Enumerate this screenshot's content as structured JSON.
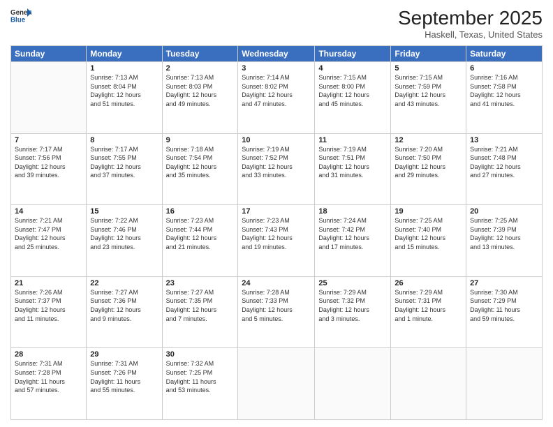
{
  "header": {
    "logo_line1": "General",
    "logo_line2": "Blue",
    "month": "September 2025",
    "location": "Haskell, Texas, United States"
  },
  "weekdays": [
    "Sunday",
    "Monday",
    "Tuesday",
    "Wednesday",
    "Thursday",
    "Friday",
    "Saturday"
  ],
  "weeks": [
    [
      {
        "day": "",
        "info": ""
      },
      {
        "day": "1",
        "info": "Sunrise: 7:13 AM\nSunset: 8:04 PM\nDaylight: 12 hours\nand 51 minutes."
      },
      {
        "day": "2",
        "info": "Sunrise: 7:13 AM\nSunset: 8:03 PM\nDaylight: 12 hours\nand 49 minutes."
      },
      {
        "day": "3",
        "info": "Sunrise: 7:14 AM\nSunset: 8:02 PM\nDaylight: 12 hours\nand 47 minutes."
      },
      {
        "day": "4",
        "info": "Sunrise: 7:15 AM\nSunset: 8:00 PM\nDaylight: 12 hours\nand 45 minutes."
      },
      {
        "day": "5",
        "info": "Sunrise: 7:15 AM\nSunset: 7:59 PM\nDaylight: 12 hours\nand 43 minutes."
      },
      {
        "day": "6",
        "info": "Sunrise: 7:16 AM\nSunset: 7:58 PM\nDaylight: 12 hours\nand 41 minutes."
      }
    ],
    [
      {
        "day": "7",
        "info": "Sunrise: 7:17 AM\nSunset: 7:56 PM\nDaylight: 12 hours\nand 39 minutes."
      },
      {
        "day": "8",
        "info": "Sunrise: 7:17 AM\nSunset: 7:55 PM\nDaylight: 12 hours\nand 37 minutes."
      },
      {
        "day": "9",
        "info": "Sunrise: 7:18 AM\nSunset: 7:54 PM\nDaylight: 12 hours\nand 35 minutes."
      },
      {
        "day": "10",
        "info": "Sunrise: 7:19 AM\nSunset: 7:52 PM\nDaylight: 12 hours\nand 33 minutes."
      },
      {
        "day": "11",
        "info": "Sunrise: 7:19 AM\nSunset: 7:51 PM\nDaylight: 12 hours\nand 31 minutes."
      },
      {
        "day": "12",
        "info": "Sunrise: 7:20 AM\nSunset: 7:50 PM\nDaylight: 12 hours\nand 29 minutes."
      },
      {
        "day": "13",
        "info": "Sunrise: 7:21 AM\nSunset: 7:48 PM\nDaylight: 12 hours\nand 27 minutes."
      }
    ],
    [
      {
        "day": "14",
        "info": "Sunrise: 7:21 AM\nSunset: 7:47 PM\nDaylight: 12 hours\nand 25 minutes."
      },
      {
        "day": "15",
        "info": "Sunrise: 7:22 AM\nSunset: 7:46 PM\nDaylight: 12 hours\nand 23 minutes."
      },
      {
        "day": "16",
        "info": "Sunrise: 7:23 AM\nSunset: 7:44 PM\nDaylight: 12 hours\nand 21 minutes."
      },
      {
        "day": "17",
        "info": "Sunrise: 7:23 AM\nSunset: 7:43 PM\nDaylight: 12 hours\nand 19 minutes."
      },
      {
        "day": "18",
        "info": "Sunrise: 7:24 AM\nSunset: 7:42 PM\nDaylight: 12 hours\nand 17 minutes."
      },
      {
        "day": "19",
        "info": "Sunrise: 7:25 AM\nSunset: 7:40 PM\nDaylight: 12 hours\nand 15 minutes."
      },
      {
        "day": "20",
        "info": "Sunrise: 7:25 AM\nSunset: 7:39 PM\nDaylight: 12 hours\nand 13 minutes."
      }
    ],
    [
      {
        "day": "21",
        "info": "Sunrise: 7:26 AM\nSunset: 7:37 PM\nDaylight: 12 hours\nand 11 minutes."
      },
      {
        "day": "22",
        "info": "Sunrise: 7:27 AM\nSunset: 7:36 PM\nDaylight: 12 hours\nand 9 minutes."
      },
      {
        "day": "23",
        "info": "Sunrise: 7:27 AM\nSunset: 7:35 PM\nDaylight: 12 hours\nand 7 minutes."
      },
      {
        "day": "24",
        "info": "Sunrise: 7:28 AM\nSunset: 7:33 PM\nDaylight: 12 hours\nand 5 minutes."
      },
      {
        "day": "25",
        "info": "Sunrise: 7:29 AM\nSunset: 7:32 PM\nDaylight: 12 hours\nand 3 minutes."
      },
      {
        "day": "26",
        "info": "Sunrise: 7:29 AM\nSunset: 7:31 PM\nDaylight: 12 hours\nand 1 minute."
      },
      {
        "day": "27",
        "info": "Sunrise: 7:30 AM\nSunset: 7:29 PM\nDaylight: 11 hours\nand 59 minutes."
      }
    ],
    [
      {
        "day": "28",
        "info": "Sunrise: 7:31 AM\nSunset: 7:28 PM\nDaylight: 11 hours\nand 57 minutes."
      },
      {
        "day": "29",
        "info": "Sunrise: 7:31 AM\nSunset: 7:26 PM\nDaylight: 11 hours\nand 55 minutes."
      },
      {
        "day": "30",
        "info": "Sunrise: 7:32 AM\nSunset: 7:25 PM\nDaylight: 11 hours\nand 53 minutes."
      },
      {
        "day": "",
        "info": ""
      },
      {
        "day": "",
        "info": ""
      },
      {
        "day": "",
        "info": ""
      },
      {
        "day": "",
        "info": ""
      }
    ]
  ]
}
